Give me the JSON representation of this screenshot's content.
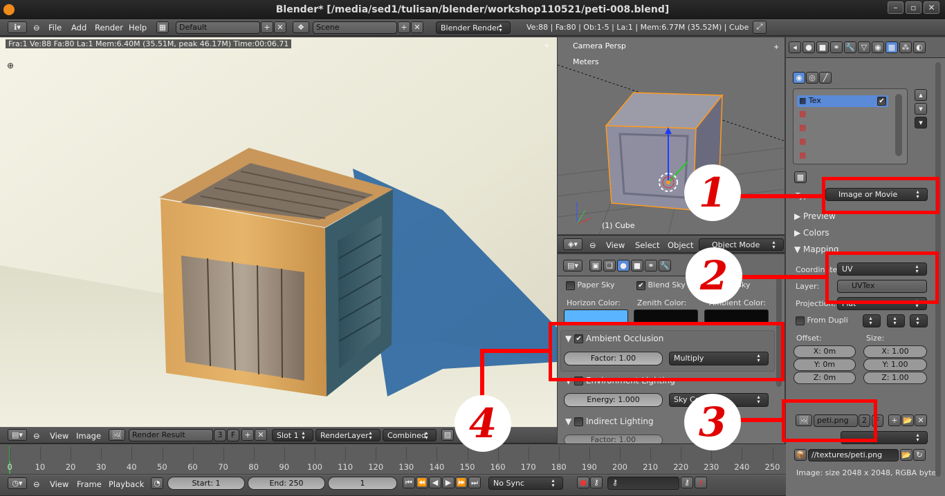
{
  "window": {
    "title": "Blender* [/media/sed1/tulisan/blender/workshop110521/peti-008.blend]",
    "btn_min": "–",
    "btn_max": "▫",
    "btn_close": "✕"
  },
  "infobar": {
    "menu": [
      "File",
      "Add",
      "Render",
      "Help"
    ],
    "screen": "Default",
    "scene": "Scene",
    "engine": "Blender Render",
    "stats": "Ve:88 | Fa:80 | Ob:1-5 | La:1 | Mem:6.77M (35.52M) | Cube"
  },
  "render": {
    "info": "Fra:1  Ve:88 Fa:80 La:1 Mem:6.40M (35.51M, peak 46.17M) Time:00:06.71"
  },
  "image_header": {
    "menu": [
      "View",
      "Image"
    ],
    "image_name": "Render Result",
    "users": "3",
    "fake": "F",
    "slot": "Slot 1",
    "layer": "RenderLayer",
    "pass": "Combined"
  },
  "viewport3d": {
    "persp": "Camera Persp",
    "units": "Meters",
    "object_label": "(1) Cube",
    "menu": [
      "View",
      "Select",
      "Object"
    ],
    "mode": "Object Mode"
  },
  "world": {
    "paper_sky": "Paper Sky",
    "blend_sky": "Blend Sky",
    "real_sky": "Sky",
    "horizon_label": "Horizon Color:",
    "zenith_label": "Zenith Color:",
    "ambient_label": "Ambient Color:",
    "horizon_color": "#5ab4ff",
    "zenith_color": "#0a0a0a",
    "ambient_color": "#0a0a0a",
    "ao_title": "Ambient Occlusion",
    "ao_factor": "Factor: 1.00",
    "ao_blend": "Multiply",
    "env_title": "Environment Lighting",
    "env_energy": "Energy: 1.000",
    "env_color": "Sky Color",
    "indirect_title": "Indirect Lighting",
    "indirect_factor": "Factor: 1.00"
  },
  "texture": {
    "slots": [
      "Tex",
      "",
      "",
      "",
      ""
    ],
    "type_label": "Type",
    "type_value": "Image or Movie",
    "preview": "Preview",
    "colors": "Colors",
    "mapping": "Mapping",
    "coord_label": "Coordinates:",
    "coord_value": "UV",
    "layer_label": "Layer:",
    "layer_value": "UVTex",
    "proj_label": "Projection:",
    "proj_value": "Flat",
    "from_dupli": "From Dupli",
    "offset_label": "Offset:",
    "size_label": "Size:",
    "offset": [
      "X: 0m",
      "Y: 0m",
      "Z: 0m"
    ],
    "size": [
      "X: 1.00",
      "Y: 1.00",
      "Z: 1.00"
    ],
    "img_name": "peti.png",
    "img_users": "2",
    "img_fake": "F",
    "img_path": "//textures/peti.png",
    "img_info": "Image: size 2048 x 2048, RGBA byte"
  },
  "timeline": {
    "ticks": [
      "0",
      "10",
      "20",
      "30",
      "40",
      "50",
      "60",
      "70",
      "80",
      "90",
      "100",
      "110",
      "120",
      "130",
      "140",
      "150",
      "160",
      "170",
      "180",
      "190",
      "200",
      "210",
      "220",
      "230",
      "240",
      "250"
    ],
    "menu": [
      "View",
      "Frame",
      "Playback"
    ],
    "start": "Start: 1",
    "end": "End: 250",
    "current": "1",
    "sync": "No Sync"
  },
  "annotations": [
    "1",
    "2",
    "3",
    "4"
  ],
  "colors": {
    "accent_red": "#ff0000",
    "selection_orange": "#ff9a1f"
  }
}
